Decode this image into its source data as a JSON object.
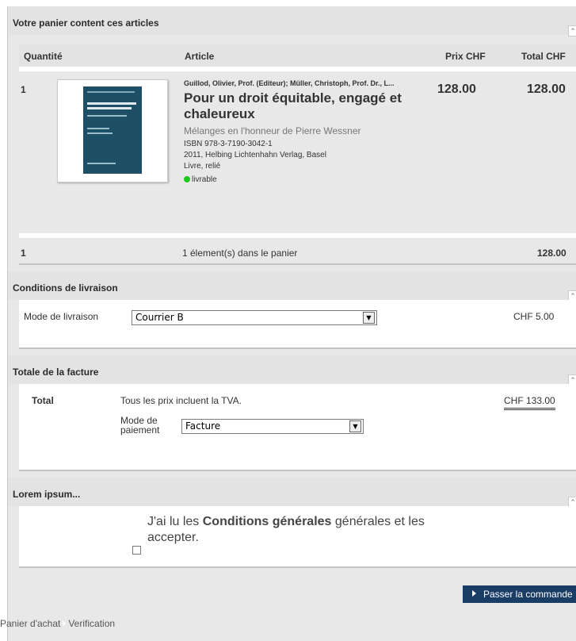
{
  "cart": {
    "section_title": "Votre panier content ces articles",
    "headers": {
      "qty": "Quantité",
      "article": "Article",
      "price": "Prix CHF",
      "total": "Total CHF"
    },
    "item": {
      "qty": "1",
      "authors": "Guillod, Olivier, Prof. (Editeur); Müller, Christoph, Prof. Dr., L...",
      "title": "Pour un droit équitable, engagé et chaleureux",
      "subtitle": "Mélanges en l'honneur de Pierre Wessner",
      "isbn": "ISBN 978-3-7190-3042-1",
      "publisher": "2011, Helbing Lichtenhahn Verlag, Basel",
      "format": "Livre, relié",
      "availability": "livrable",
      "price": "128.00",
      "total": "128.00"
    },
    "summary": {
      "qty": "1",
      "text": "1 élement(s) dans le panier",
      "total": "128.00"
    }
  },
  "delivery": {
    "section_title": "Conditions de livraison",
    "mode_label": "Mode de livraison",
    "mode_value": "Courrier B",
    "cost": "CHF 5.00"
  },
  "invoice": {
    "section_title": "Totale de la facture",
    "total_label": "Total",
    "vat_note": "Tous les prix incluent la TVA.",
    "total_value": "CHF 133.00",
    "payment_label_1": "Mode de",
    "payment_label_2": "paiement",
    "payment_value": "Facture"
  },
  "terms": {
    "section_title": "Lorem ipsum...",
    "text_pre": "J'ai lu les ",
    "text_bold": "Conditions générales",
    "text_post_1": " générales et les",
    "text_post_2": "accepter."
  },
  "actions": {
    "submit_label": "Passer la commande"
  },
  "breadcrumb": {
    "item1": "Panier d'achat",
    "item2": "Verification"
  },
  "colors": {
    "button_bg": "#1a3d66",
    "available_dot": "#1ec81e",
    "section_bg": "#e3e3e3"
  }
}
